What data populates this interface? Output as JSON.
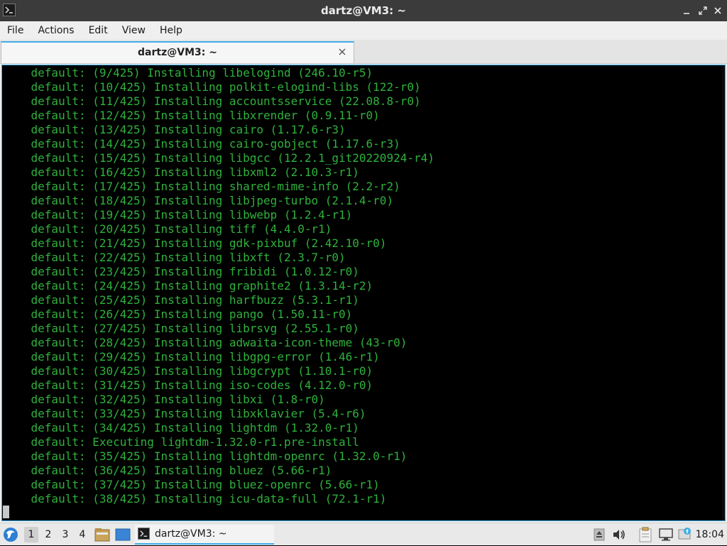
{
  "window": {
    "title": "dartz@VM3: ~",
    "controls": {
      "minimize_icon": "minimize-icon",
      "maximize_icon": "maximize-icon",
      "close_icon": "close-icon"
    }
  },
  "menu": {
    "items": [
      "File",
      "Actions",
      "Edit",
      "View",
      "Help"
    ]
  },
  "tabs": [
    {
      "label": "dartz@VM3: ~",
      "active": true
    }
  ],
  "terminal": {
    "text_color": "#2fb13c",
    "background": "#000000",
    "lines": [
      "    default: (9/425) Installing libelogind (246.10-r5)",
      "    default: (10/425) Installing polkit-elogind-libs (122-r0)",
      "    default: (11/425) Installing accountsservice (22.08.8-r0)",
      "    default: (12/425) Installing libxrender (0.9.11-r0)",
      "    default: (13/425) Installing cairo (1.17.6-r3)",
      "    default: (14/425) Installing cairo-gobject (1.17.6-r3)",
      "    default: (15/425) Installing libgcc (12.2.1_git20220924-r4)",
      "    default: (16/425) Installing libxml2 (2.10.3-r1)",
      "    default: (17/425) Installing shared-mime-info (2.2-r2)",
      "    default: (18/425) Installing libjpeg-turbo (2.1.4-r0)",
      "    default: (19/425) Installing libwebp (1.2.4-r1)",
      "    default: (20/425) Installing tiff (4.4.0-r1)",
      "    default: (21/425) Installing gdk-pixbuf (2.42.10-r0)",
      "    default: (22/425) Installing libxft (2.3.7-r0)",
      "    default: (23/425) Installing fribidi (1.0.12-r0)",
      "    default: (24/425) Installing graphite2 (1.3.14-r2)",
      "    default: (25/425) Installing harfbuzz (5.3.1-r1)",
      "    default: (26/425) Installing pango (1.50.11-r0)",
      "    default: (27/425) Installing librsvg (2.55.1-r0)",
      "    default: (28/425) Installing adwaita-icon-theme (43-r0)",
      "    default: (29/425) Installing libgpg-error (1.46-r1)",
      "    default: (30/425) Installing libgcrypt (1.10.1-r0)",
      "    default: (31/425) Installing iso-codes (4.12.0-r0)",
      "    default: (32/425) Installing libxi (1.8-r0)",
      "    default: (33/425) Installing libxklavier (5.4-r6)",
      "    default: (34/425) Installing lightdm (1.32.0-r1)",
      "    default: Executing lightdm-1.32.0-r1.pre-install",
      "    default: (35/425) Installing lightdm-openrc (1.32.0-r1)",
      "    default: (36/425) Installing bluez (5.66-r1)",
      "    default: (37/425) Installing bluez-openrc (5.66-r1)",
      "    default: (38/425) Installing icu-data-full (72.1-r1)"
    ]
  },
  "taskbar": {
    "desktops": [
      "1",
      "2",
      "3",
      "4"
    ],
    "active_desktop": "1",
    "task_label": "dartz@VM3: ~",
    "tray_icons": [
      "eject-icon",
      "volume-icon",
      "clipboard-icon",
      "network-icon",
      "update-icon"
    ],
    "clock": "18:04",
    "accent_color": "#3daee9"
  }
}
